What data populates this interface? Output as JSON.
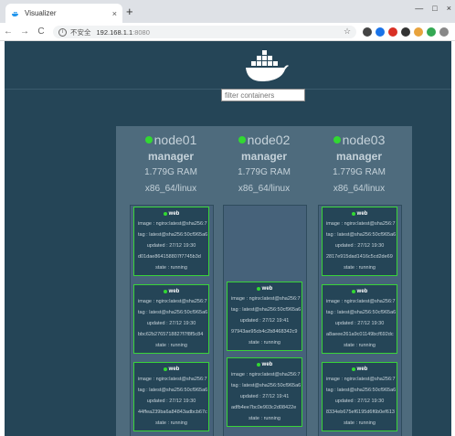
{
  "browser": {
    "tab_title": "Visualizer",
    "tab_close": "×",
    "new_tab": "+",
    "window_controls": [
      "—",
      "□",
      "×"
    ],
    "nav": {
      "back": "←",
      "forward": "→",
      "reload": "C"
    },
    "security_label": "不安全",
    "url_host": "192.168.1.1",
    "url_port": ":8080",
    "star": "☆"
  },
  "app": {
    "filter_placeholder": "filter containers",
    "nodes": [
      {
        "name": "node01",
        "role": "manager",
        "ram": "1.779G RAM",
        "arch": "x86_64/linux",
        "tasks": [
          {
            "name": "web",
            "image": "image : nginx:latest@sha256:7",
            "tag": "tag : latest@sha256:50cf965a6",
            "updated": "updated : 27/12 19:30",
            "id": "d01dae864158807f7745b3d",
            "state": "state : running"
          },
          {
            "name": "web",
            "image": "image : nginx:latest@sha256:7",
            "tag": "tag : latest@sha256:50cf965a6",
            "updated": "updated : 27/12 19:30",
            "id": "bbc62b2765718827f7f8f5c84",
            "state": "state : running"
          },
          {
            "name": "web",
            "image": "image : nginx:latest@sha256:7",
            "tag": "tag : latest@sha256:50cf965a6",
            "updated": "updated : 27/12 19:30",
            "id": "44ffea239ba6a84843adbcb67c",
            "state": "state : running"
          }
        ]
      },
      {
        "name": "node02",
        "role": "manager",
        "ram": "1.779G RAM",
        "arch": "x86_64/linux",
        "tasks": [
          {
            "name": "web",
            "image": "image : nginx:latest@sha256:7",
            "tag": "tag : latest@sha256:50cf965a6",
            "updated": "updated : 27/12 19:41",
            "id": "97943ae95cb4c2b8468342c9",
            "state": "state : running"
          },
          {
            "name": "web",
            "image": "image : nginx:latest@sha256:7",
            "tag": "tag : latest@sha256:50cf965a6",
            "updated": "updated : 27/12 19:41",
            "id": "adfb4ee7bc0e903c2d08422e",
            "state": "state : running"
          }
        ]
      },
      {
        "name": "node03",
        "role": "manager",
        "ram": "1.779G RAM",
        "arch": "x86_64/linux",
        "tasks": [
          {
            "name": "web",
            "image": "image : nginx:latest@sha256:7",
            "tag": "tag : latest@sha256:50cf965a6",
            "updated": "updated : 27/12 19:30",
            "id": "2817e915dad1416c5cd2de69",
            "state": "state : running"
          },
          {
            "name": "web",
            "image": "image : nginx:latest@sha256:7",
            "tag": "tag : latest@sha256:50cf965a6",
            "updated": "updated : 27/12 19:30",
            "id": "a8aeee261a9c01149bcf692dc",
            "state": "state : running"
          },
          {
            "name": "web",
            "image": "image : nginx:latest@sha256:7",
            "tag": "tag : latest@sha256:50cf965a6",
            "updated": "updated : 27/12 19:30",
            "id": "8334eb675ef6195d6f6b0ef613",
            "state": "state : running"
          }
        ]
      }
    ]
  },
  "colors": {
    "background": "#254557",
    "cluster": "#4e6b7d",
    "running": "#32d832",
    "task_border": "#39d339"
  }
}
